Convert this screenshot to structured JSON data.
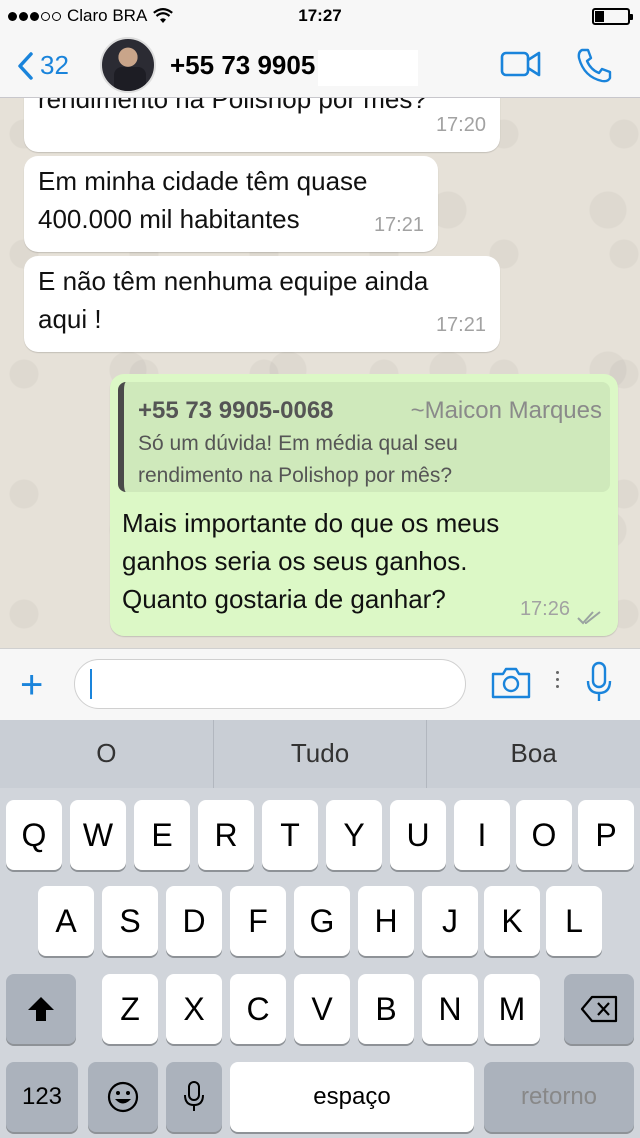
{
  "status_bar": {
    "carrier": "Claro BRA",
    "time": "17:27"
  },
  "nav": {
    "back_count": "32",
    "contact_name": "+55 73 9905"
  },
  "messages": [
    {
      "text_lines": [
        "rendimento na Polishop por mês?"
      ],
      "time": "17:20"
    },
    {
      "text_lines": [
        "Em minha cidade têm quase",
        "400.000 mil habitantes"
      ],
      "time": "17:21"
    },
    {
      "text_lines": [
        "E não têm nenhuma equipe ainda",
        "aqui !"
      ],
      "time": "17:21"
    },
    {
      "quote": {
        "number": "+55 73 9905-0068",
        "name": "~Maicon Marques",
        "lines": [
          "Só um dúvida! Em média qual seu",
          "rendimento na Polishop por mês?"
        ]
      },
      "text_lines": [
        "Mais importante do que os meus",
        "ganhos seria os seus ganhos.",
        "Quanto gostaria de ganhar?"
      ],
      "time": "17:26"
    }
  ],
  "input": {
    "value": "",
    "placeholder": ""
  },
  "keyboard": {
    "predictions": [
      "O",
      "Tudo",
      "Boa"
    ],
    "row1": [
      "Q",
      "W",
      "E",
      "R",
      "T",
      "Y",
      "U",
      "I",
      "O",
      "P"
    ],
    "row2": [
      "A",
      "S",
      "D",
      "F",
      "G",
      "H",
      "J",
      "K",
      "L"
    ],
    "row3": [
      "Z",
      "X",
      "C",
      "V",
      "B",
      "N",
      "M"
    ],
    "numbers_label": "123",
    "space_label": "espaço",
    "return_label": "retorno"
  },
  "colors": {
    "accent": "#1a84db",
    "outgoing_bubble": "#dcf8c6",
    "incoming_bubble": "#ffffff",
    "read_ticks": "#9aa3a0"
  }
}
